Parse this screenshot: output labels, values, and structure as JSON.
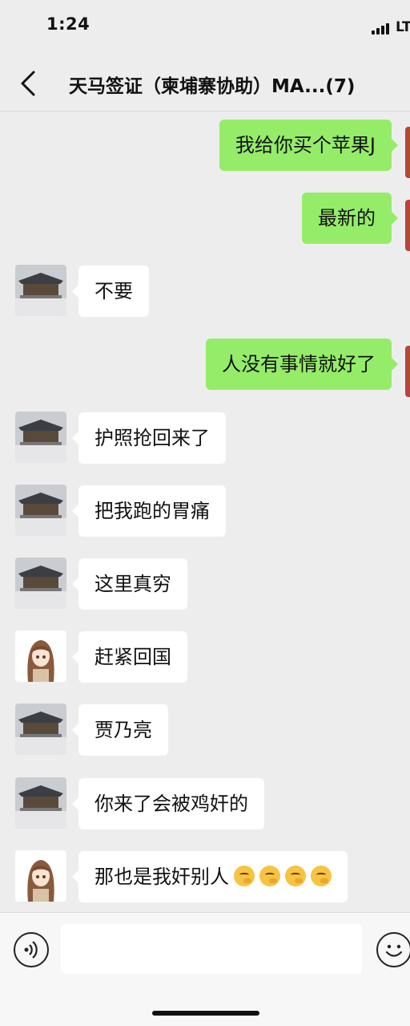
{
  "status_bar": {
    "time": "1:24",
    "carrier": "LT",
    "signal_icon": "signal-bars-icon"
  },
  "nav": {
    "back_icon": "chevron-left-icon",
    "title": "天马签证（柬埔寨协助）MA...(7)"
  },
  "colors": {
    "outgoing_bubble": "#95ec69",
    "incoming_bubble": "#ffffff",
    "background": "#ededed"
  },
  "messages": [
    {
      "direction": "out",
      "text": "我给你买个苹果J"
    },
    {
      "direction": "out",
      "text": "最新的"
    },
    {
      "direction": "in",
      "sender_avatar": "palace-avatar",
      "text": "不要"
    },
    {
      "direction": "out",
      "text": "人没有事情就好了"
    },
    {
      "direction": "in",
      "sender_avatar": "palace-avatar",
      "text": "护照抢回来了"
    },
    {
      "direction": "in",
      "sender_avatar": "palace-avatar",
      "text": "把我跑的胃痛"
    },
    {
      "direction": "in",
      "sender_avatar": "palace-avatar",
      "text": "这里真穷"
    },
    {
      "direction": "in",
      "sender_avatar": "anime-girl-avatar",
      "text": "赶紧回国"
    },
    {
      "direction": "in",
      "sender_avatar": "palace-avatar",
      "text": "贾乃亮"
    },
    {
      "direction": "in",
      "sender_avatar": "palace-avatar",
      "text": "你来了会被鸡奸的"
    },
    {
      "direction": "in",
      "sender_avatar": "anime-girl-avatar",
      "text": "那也是我奸别人",
      "emoji_count": 4,
      "emoji": "thinking-face-emoji"
    }
  ],
  "input_bar": {
    "voice_icon": "voice-icon",
    "message_value": "",
    "emoji_icon": "smiley-icon"
  }
}
